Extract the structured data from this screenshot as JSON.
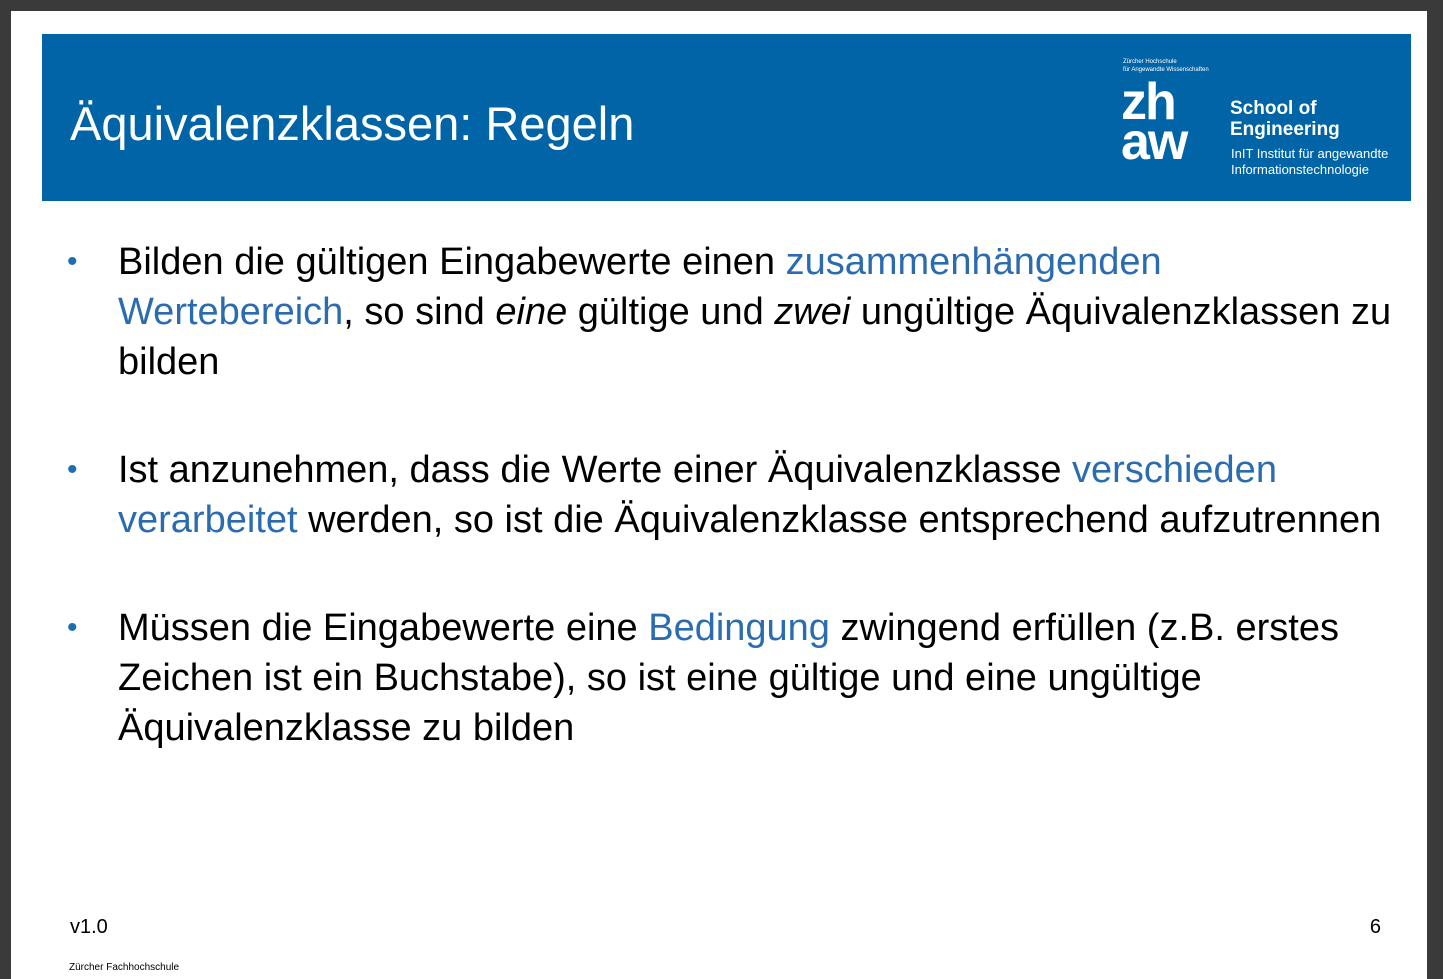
{
  "slide": {
    "title": "Äquivalenzklassen: Regeln",
    "logo": {
      "small_line1": "Zürcher Hochschule",
      "small_line2": "für Angewandte Wissenschaften",
      "mark_line1": "zh",
      "mark_line2": "aw",
      "school_line1": "School of",
      "school_line2": "Engineering",
      "institute_line1": "InIT Institut für angewandte",
      "institute_line2": "Informationstechnologie"
    },
    "bullets": [
      {
        "t1": "Bilden die gültigen Eingabewerte einen ",
        "h1": "zusammenhängenden Wertebereich",
        "t2": ", so sind ",
        "e1": "eine",
        "t3": " gültige und ",
        "e2": "zwei",
        "t4": " ungültige Äquivalenzklassen zu bilden"
      },
      {
        "t1": "Ist anzunehmen, dass die Werte einer Äquivalenzklasse ",
        "h1": "verschieden verarbeitet",
        "t2": " werden, so ist die Äquivalenzklasse entsprechend aufzutrennen"
      },
      {
        "t1": "Müssen die Eingabewerte eine ",
        "h1": "Bedingung",
        "t2": " zwingend erfüllen (z.B. erstes Zeichen ist ein Buchstabe), so ist eine gültige und eine ungültige Äquivalenzklasse zu bilden"
      }
    ],
    "bullet_symbol": "•",
    "version": "v1.0",
    "page_number": "6",
    "footer_org": "Zürcher Fachhochschule"
  },
  "colors": {
    "header_blue": "#0064a6",
    "highlight_blue": "#2b6cb1",
    "viewer_background": "#3a3a3a"
  }
}
